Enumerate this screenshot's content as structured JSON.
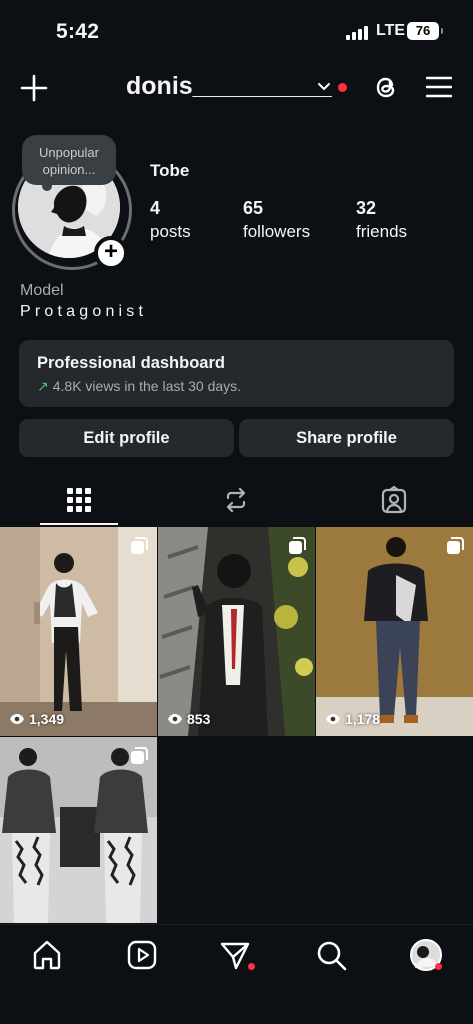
{
  "status_bar": {
    "time": "5:42",
    "network": "LTE",
    "battery": "76"
  },
  "header": {
    "username": "donis__________"
  },
  "profile": {
    "note": "Unpopular opinion...",
    "display_name": "Tobe",
    "stats": [
      {
        "value": "4",
        "label": "posts"
      },
      {
        "value": "65",
        "label": "followers"
      },
      {
        "value": "32",
        "label": "friends"
      }
    ],
    "category": "Model",
    "bio": "Protagonist"
  },
  "dashboard": {
    "title": "Professional dashboard",
    "subtitle": "4.8K views in the last 30 days."
  },
  "buttons": {
    "edit": "Edit profile",
    "share": "Share profile"
  },
  "posts": [
    {
      "views": "1,349",
      "multi": true
    },
    {
      "views": "853",
      "multi": true
    },
    {
      "views": "1,178",
      "multi": true
    },
    {
      "views": "",
      "multi": true
    }
  ],
  "colors": {
    "background": "#0c1014",
    "card": "#25292e",
    "notification": "#ff3040",
    "trend": "#3fc36a"
  },
  "icons": {
    "top_bar": [
      "plus-icon",
      "chevron-down-icon",
      "threads-icon",
      "menu-icon"
    ],
    "tabs": [
      "grid-icon",
      "reposts-icon",
      "tagged-icon"
    ],
    "nav": [
      "home-icon",
      "reels-icon",
      "messages-icon",
      "search-icon",
      "profile-avatar"
    ]
  }
}
